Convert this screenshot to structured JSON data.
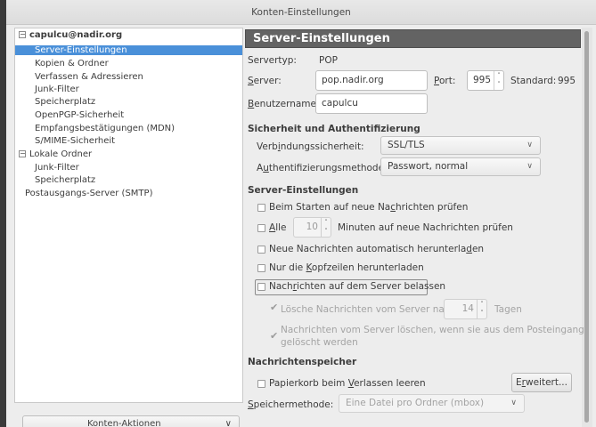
{
  "window": {
    "title": "Konten-Einstellungen"
  },
  "tree": {
    "items": [
      {
        "label": "capulcu@nadir.org",
        "level": 0,
        "toggle": "−",
        "bold": true
      },
      {
        "label": "Server-Einstellungen",
        "level": 1,
        "selected": true
      },
      {
        "label": "Kopien & Ordner",
        "level": 1
      },
      {
        "label": "Verfassen & Adressieren",
        "level": 1
      },
      {
        "label": "Junk-Filter",
        "level": 1
      },
      {
        "label": "Speicherplatz",
        "level": 1
      },
      {
        "label": "OpenPGP-Sicherheit",
        "level": 1
      },
      {
        "label": "Empfangsbestätigungen (MDN)",
        "level": 1
      },
      {
        "label": "S/MIME-Sicherheit",
        "level": 1
      },
      {
        "label": "Lokale Ordner",
        "level": 0,
        "toggle": "−"
      },
      {
        "label": "Junk-Filter",
        "level": 1
      },
      {
        "label": "Speicherplatz",
        "level": 1
      },
      {
        "label": "Postausgangs-Server (SMTP)",
        "level": 0
      }
    ],
    "account_actions_label": "Konten-Aktionen",
    "account_actions_arrow": "∨"
  },
  "header": {
    "title": "Server-Einstellungen"
  },
  "server": {
    "type_label": "Servertyp:",
    "type_value": "POP",
    "server_label_a": "S",
    "server_label_b": "erver:",
    "server_value": "pop.nadir.org",
    "port_label_a": "P",
    "port_label_b": "ort:",
    "port_value": "995",
    "standard_label": "Standard:",
    "standard_value": "995",
    "username_label_a": "B",
    "username_label_b": "enutzername:",
    "username_value": "capulcu"
  },
  "security": {
    "heading": "Sicherheit und Authentifizierung",
    "connection_label_a": "Verb",
    "connection_label_u": "i",
    "connection_label_b": "ndungssicherheit:",
    "connection_value": "SSL/TLS",
    "auth_label_a": "A",
    "auth_label_u": "u",
    "auth_label_b": "thentifizierungsmethode:",
    "auth_value": "Passwort, normal"
  },
  "server_settings": {
    "heading": "Server-Einstellungen",
    "check_on_start_a": "Beim Starten auf neue Na",
    "check_on_start_u": "c",
    "check_on_start_b": "hrichten prüfen",
    "check_every_u": "A",
    "check_every_b": "lle",
    "check_every_value": "10",
    "check_every_suffix": "Minuten auf neue Nachrichten prüfen",
    "auto_download_a": "Neue Nachrichten automatisch herunterla",
    "auto_download_u": "d",
    "auto_download_b": "en",
    "headers_only_a": "Nur die ",
    "headers_only_u": "K",
    "headers_only_b": "opfzeilen herunterladen",
    "leave_on_server_a": "Nach",
    "leave_on_server_u": "r",
    "leave_on_server_b": "ichten auf dem Server belassen",
    "delete_after_label": "Lösche Nachrichten vom Server nach",
    "delete_after_value": "14",
    "delete_after_suffix": "Tagen",
    "delete_when_removed_line1": "Nachrichten vom Server löschen, wenn sie aus dem Posteingang",
    "delete_when_removed_line2": "gelöscht werden"
  },
  "storage": {
    "heading": "Nachrichtenspeicher",
    "empty_trash_a": "Papierkorb beim ",
    "empty_trash_u": "V",
    "empty_trash_b": "erlassen leeren",
    "advanced_a": "E",
    "advanced_u": "r",
    "advanced_b": "weitert...",
    "method_label_a": "S",
    "method_label_b": "peichermethode:",
    "method_value": "Eine Datei pro Ordner (mbox)"
  },
  "icons": {
    "spin": "⌃⌄",
    "chevron": "∨",
    "check": "✔"
  },
  "colors": {
    "header_bg": "#636363",
    "selection": "#4a90d9",
    "window_bg": "#ededed"
  }
}
